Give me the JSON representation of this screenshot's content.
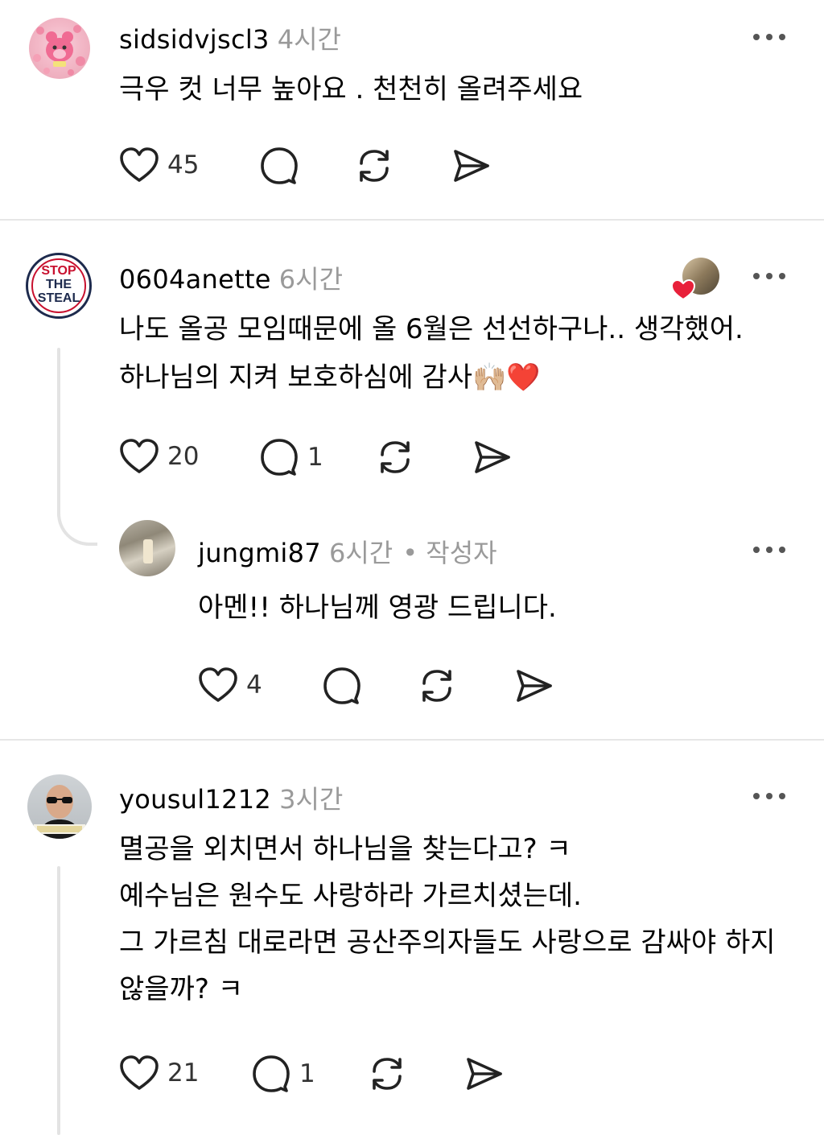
{
  "comments": [
    {
      "username": "sidsidvjscl3",
      "time": "4시간",
      "lines": [
        "극우 컷 너무 높아요 . 천천히 올려주세요"
      ],
      "likes": "45",
      "replies": ""
    },
    {
      "username": "0604anette",
      "time": "6시간",
      "lines": [
        "나도 올공 모임때문에 올 6월은 선선하구나.. 생각했어.",
        "하나님의 지켜 보호하심에 감사🙌🏼❤️"
      ],
      "likes": "20",
      "replies": "1",
      "avatar_text": [
        "STOP",
        "THE",
        "STEAL"
      ]
    },
    {
      "username": "jungmi87",
      "time": "6시간",
      "author_tag": "• 작성자",
      "lines": [
        "아멘!! 하나님께 영광 드립니다."
      ],
      "likes": "4",
      "replies": ""
    },
    {
      "username": "yousul1212",
      "time": "3시간",
      "lines": [
        "멸공을 외치면서 하나님을 찾는다고? ㅋ",
        "예수님은 원수도 사랑하라 가르치셨는데.",
        "그 가르침 대로라면 공산주의자들도 사랑으로 감싸야 하지",
        "않을까? ㅋ"
      ],
      "likes": "21",
      "replies": "1"
    }
  ],
  "icons": {
    "like": "heart-icon",
    "reply": "comment-bubble-icon",
    "repost": "repost-icon",
    "share": "send-icon",
    "more": "more-options-icon"
  },
  "colors": {
    "like_badge": "#e8203a",
    "muted_text": "#9a9a9a"
  }
}
